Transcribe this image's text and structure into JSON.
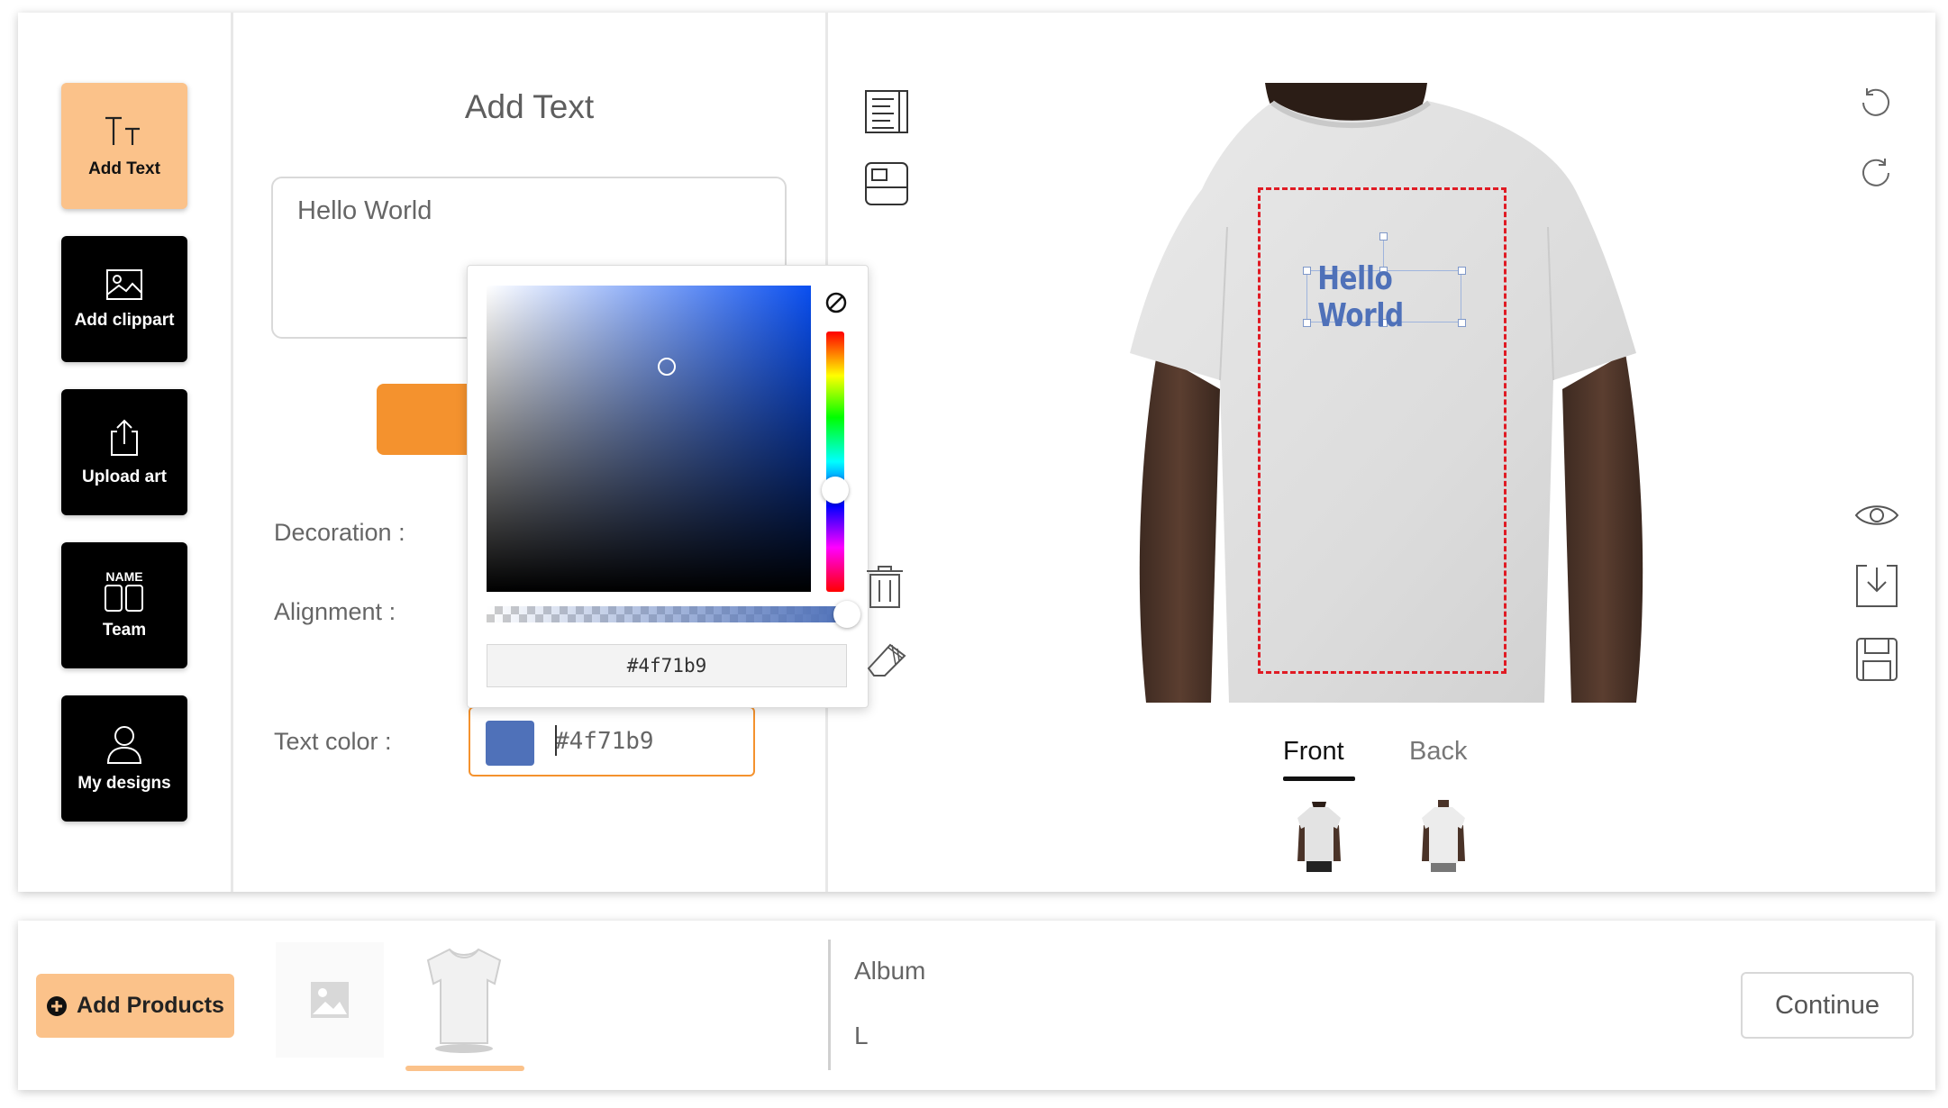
{
  "sidebar": {
    "items": [
      {
        "label": "Add Text",
        "icon": "text-icon",
        "active": true
      },
      {
        "label": "Add clippart",
        "icon": "image-icon",
        "active": false
      },
      {
        "label": "Upload art",
        "icon": "upload-icon",
        "active": false
      },
      {
        "label": "Team",
        "icon": "team-name-icon",
        "active": false,
        "icon_caption": "NAME"
      },
      {
        "label": "My designs",
        "icon": "user-icon",
        "active": false
      }
    ]
  },
  "text_panel": {
    "title": "Add Text",
    "text_value": "Hello World",
    "decoration_label": "Decoration :",
    "alignment_label": "Alignment :",
    "text_color_label": "Text color :",
    "text_color_value": "#4f71b9"
  },
  "color_picker": {
    "hex_value": "#4f71b9",
    "selected_color": "#4f71b9"
  },
  "canvas": {
    "design_text": "Hello World",
    "design_color": "#4f71b9",
    "tabs": [
      {
        "label": "Front",
        "active": true
      },
      {
        "label": "Back",
        "active": false
      }
    ]
  },
  "bottom_bar": {
    "add_products_label": "Add Products",
    "album_label": "Album",
    "size_label": "L",
    "continue_label": "Continue"
  },
  "colors": {
    "accent_orange": "#f4922e",
    "active_tool_bg": "#fbc28a",
    "print_area_border": "#e01b24"
  }
}
